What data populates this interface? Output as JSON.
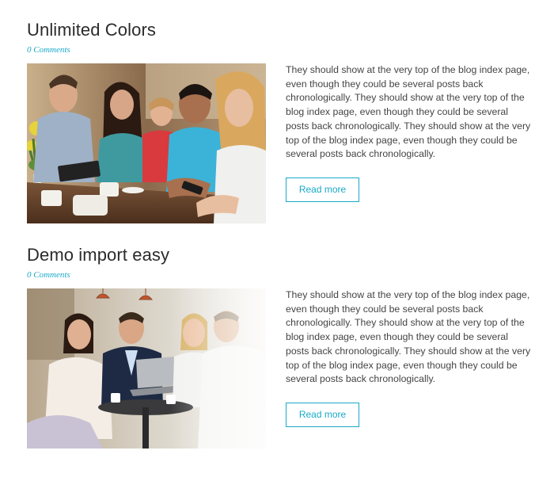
{
  "posts": [
    {
      "title": "Unlimited Colors",
      "comments": "0 Comments",
      "excerpt": "They should show at the very top of the blog index page, even though they could be several posts back chronologically. They should show at the very top of the blog index page, even though they could be several posts back chronologically. They should show at the very top of the blog index page, even though they could be several posts back chronologically.",
      "read_more": "Read more",
      "image_alt": "People in a cafe looking at smartphones"
    },
    {
      "title": "Demo import easy",
      "comments": "0 Comments",
      "excerpt": "They should show at the very top of the blog index page, even though they could be several posts back chronologically. They should show at the very top of the blog index page, even though they could be several posts back chronologically. They should show at the very top of the blog index page, even though they could be several posts back chronologically.",
      "read_more": "Read more",
      "image_alt": "Business team meeting around a laptop"
    }
  ],
  "colors": {
    "accent": "#1aa9c9",
    "title": "#2b2b2b",
    "text": "#444444"
  }
}
